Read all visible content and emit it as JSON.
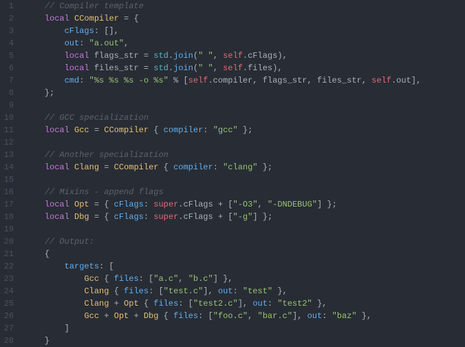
{
  "lines": [
    {
      "n": "1",
      "tokens": [
        [
          "    ",
          "c-white"
        ],
        [
          "// Compiler template",
          "c-comment"
        ]
      ]
    },
    {
      "n": "2",
      "tokens": [
        [
          "    ",
          "c-white"
        ],
        [
          "local",
          "c-keyword"
        ],
        [
          " ",
          "c-white"
        ],
        [
          "CCompiler",
          "c-def"
        ],
        [
          " = {",
          "c-punc"
        ]
      ]
    },
    {
      "n": "3",
      "tokens": [
        [
          "        ",
          "c-white"
        ],
        [
          "cFlags",
          "c-prop"
        ],
        [
          ":",
          "c-punc"
        ],
        [
          " [],",
          "c-punc"
        ]
      ]
    },
    {
      "n": "4",
      "tokens": [
        [
          "        ",
          "c-white"
        ],
        [
          "out",
          "c-prop"
        ],
        [
          ":",
          "c-punc"
        ],
        [
          " ",
          "c-white"
        ],
        [
          "\"a.out\"",
          "c-str"
        ],
        [
          ",",
          "c-punc"
        ]
      ]
    },
    {
      "n": "5",
      "tokens": [
        [
          "        ",
          "c-white"
        ],
        [
          "local",
          "c-keyword"
        ],
        [
          " ",
          "c-white"
        ],
        [
          "flags_str",
          "c-var"
        ],
        [
          " = ",
          "c-op"
        ],
        [
          "std",
          "c-builtin"
        ],
        [
          ".",
          "c-punc"
        ],
        [
          "join",
          "c-fn"
        ],
        [
          "(",
          "c-punc"
        ],
        [
          "\" \"",
          "c-str"
        ],
        [
          ", ",
          "c-punc"
        ],
        [
          "self",
          "c-self"
        ],
        [
          ".",
          "c-punc"
        ],
        [
          "cFlags",
          "c-var"
        ],
        [
          "),",
          "c-punc"
        ]
      ]
    },
    {
      "n": "6",
      "tokens": [
        [
          "        ",
          "c-white"
        ],
        [
          "local",
          "c-keyword"
        ],
        [
          " ",
          "c-white"
        ],
        [
          "files_str",
          "c-var"
        ],
        [
          " = ",
          "c-op"
        ],
        [
          "std",
          "c-builtin"
        ],
        [
          ".",
          "c-punc"
        ],
        [
          "join",
          "c-fn"
        ],
        [
          "(",
          "c-punc"
        ],
        [
          "\" \"",
          "c-str"
        ],
        [
          ", ",
          "c-punc"
        ],
        [
          "self",
          "c-self"
        ],
        [
          ".",
          "c-punc"
        ],
        [
          "files",
          "c-var"
        ],
        [
          "),",
          "c-punc"
        ]
      ]
    },
    {
      "n": "7",
      "tokens": [
        [
          "        ",
          "c-white"
        ],
        [
          "cmd",
          "c-prop"
        ],
        [
          ":",
          "c-punc"
        ],
        [
          " ",
          "c-white"
        ],
        [
          "\"%s %s %s -o %s\"",
          "c-str"
        ],
        [
          " % [",
          "c-punc"
        ],
        [
          "self",
          "c-self"
        ],
        [
          ".",
          "c-punc"
        ],
        [
          "compiler",
          "c-var"
        ],
        [
          ", ",
          "c-punc"
        ],
        [
          "flags_str",
          "c-var"
        ],
        [
          ", ",
          "c-punc"
        ],
        [
          "files_str",
          "c-var"
        ],
        [
          ", ",
          "c-punc"
        ],
        [
          "self",
          "c-self"
        ],
        [
          ".",
          "c-punc"
        ],
        [
          "out",
          "c-var"
        ],
        [
          "],",
          "c-punc"
        ]
      ]
    },
    {
      "n": "8",
      "tokens": [
        [
          "    };",
          "c-punc"
        ]
      ]
    },
    {
      "n": "9",
      "tokens": [
        [
          "",
          "c-white"
        ]
      ]
    },
    {
      "n": "10",
      "tokens": [
        [
          "    ",
          "c-white"
        ],
        [
          "// GCC specialization",
          "c-comment"
        ]
      ]
    },
    {
      "n": "11",
      "tokens": [
        [
          "    ",
          "c-white"
        ],
        [
          "local",
          "c-keyword"
        ],
        [
          " ",
          "c-white"
        ],
        [
          "Gcc",
          "c-def"
        ],
        [
          " = ",
          "c-punc"
        ],
        [
          "CCompiler",
          "c-def"
        ],
        [
          " { ",
          "c-punc"
        ],
        [
          "compiler",
          "c-prop"
        ],
        [
          ":",
          "c-punc"
        ],
        [
          " ",
          "c-white"
        ],
        [
          "\"gcc\"",
          "c-str"
        ],
        [
          " };",
          "c-punc"
        ]
      ]
    },
    {
      "n": "12",
      "tokens": [
        [
          "",
          "c-white"
        ]
      ]
    },
    {
      "n": "13",
      "tokens": [
        [
          "    ",
          "c-white"
        ],
        [
          "// Another specialization",
          "c-comment"
        ]
      ]
    },
    {
      "n": "14",
      "tokens": [
        [
          "    ",
          "c-white"
        ],
        [
          "local",
          "c-keyword"
        ],
        [
          " ",
          "c-white"
        ],
        [
          "Clang",
          "c-def"
        ],
        [
          " = ",
          "c-punc"
        ],
        [
          "CCompiler",
          "c-def"
        ],
        [
          " { ",
          "c-punc"
        ],
        [
          "compiler",
          "c-prop"
        ],
        [
          ":",
          "c-punc"
        ],
        [
          " ",
          "c-white"
        ],
        [
          "\"clang\"",
          "c-str"
        ],
        [
          " };",
          "c-punc"
        ]
      ]
    },
    {
      "n": "15",
      "tokens": [
        [
          "",
          "c-white"
        ]
      ]
    },
    {
      "n": "16",
      "tokens": [
        [
          "    ",
          "c-white"
        ],
        [
          "// Mixins - append flags",
          "c-comment"
        ]
      ]
    },
    {
      "n": "17",
      "tokens": [
        [
          "    ",
          "c-white"
        ],
        [
          "local",
          "c-keyword"
        ],
        [
          " ",
          "c-white"
        ],
        [
          "Opt",
          "c-def"
        ],
        [
          " = { ",
          "c-punc"
        ],
        [
          "cFlags",
          "c-prop"
        ],
        [
          ":",
          "c-punc"
        ],
        [
          " ",
          "c-white"
        ],
        [
          "super",
          "c-self"
        ],
        [
          ".",
          "c-punc"
        ],
        [
          "cFlags",
          "c-var"
        ],
        [
          " + [",
          "c-punc"
        ],
        [
          "\"-O3\"",
          "c-str"
        ],
        [
          ", ",
          "c-punc"
        ],
        [
          "\"-DNDEBUG\"",
          "c-str"
        ],
        [
          "] };",
          "c-punc"
        ]
      ]
    },
    {
      "n": "18",
      "tokens": [
        [
          "    ",
          "c-white"
        ],
        [
          "local",
          "c-keyword"
        ],
        [
          " ",
          "c-white"
        ],
        [
          "Dbg",
          "c-def"
        ],
        [
          " = { ",
          "c-punc"
        ],
        [
          "cFlags",
          "c-prop"
        ],
        [
          ":",
          "c-punc"
        ],
        [
          " ",
          "c-white"
        ],
        [
          "super",
          "c-self"
        ],
        [
          ".",
          "c-punc"
        ],
        [
          "cFlags",
          "c-var"
        ],
        [
          " + [",
          "c-punc"
        ],
        [
          "\"-g\"",
          "c-str"
        ],
        [
          "] };",
          "c-punc"
        ]
      ]
    },
    {
      "n": "19",
      "tokens": [
        [
          "",
          "c-white"
        ]
      ]
    },
    {
      "n": "20",
      "tokens": [
        [
          "    ",
          "c-white"
        ],
        [
          "// Output:",
          "c-comment"
        ]
      ]
    },
    {
      "n": "21",
      "tokens": [
        [
          "    {",
          "c-punc"
        ]
      ]
    },
    {
      "n": "22",
      "tokens": [
        [
          "        ",
          "c-white"
        ],
        [
          "targets",
          "c-prop"
        ],
        [
          ":",
          "c-punc"
        ],
        [
          " [",
          "c-punc"
        ]
      ]
    },
    {
      "n": "23",
      "tokens": [
        [
          "            ",
          "c-white"
        ],
        [
          "Gcc",
          "c-def"
        ],
        [
          " { ",
          "c-punc"
        ],
        [
          "files",
          "c-prop"
        ],
        [
          ":",
          "c-punc"
        ],
        [
          " [",
          "c-punc"
        ],
        [
          "\"a.c\"",
          "c-str"
        ],
        [
          ", ",
          "c-punc"
        ],
        [
          "\"b.c\"",
          "c-str"
        ],
        [
          "] },",
          "c-punc"
        ]
      ]
    },
    {
      "n": "24",
      "tokens": [
        [
          "            ",
          "c-white"
        ],
        [
          "Clang",
          "c-def"
        ],
        [
          " { ",
          "c-punc"
        ],
        [
          "files",
          "c-prop"
        ],
        [
          ":",
          "c-punc"
        ],
        [
          " [",
          "c-punc"
        ],
        [
          "\"test.c\"",
          "c-str"
        ],
        [
          "], ",
          "c-punc"
        ],
        [
          "out",
          "c-prop"
        ],
        [
          ":",
          "c-punc"
        ],
        [
          " ",
          "c-white"
        ],
        [
          "\"test\"",
          "c-str"
        ],
        [
          " },",
          "c-punc"
        ]
      ]
    },
    {
      "n": "25",
      "tokens": [
        [
          "            ",
          "c-white"
        ],
        [
          "Clang",
          "c-def"
        ],
        [
          " + ",
          "c-op"
        ],
        [
          "Opt",
          "c-def"
        ],
        [
          " { ",
          "c-punc"
        ],
        [
          "files",
          "c-prop"
        ],
        [
          ":",
          "c-punc"
        ],
        [
          " [",
          "c-punc"
        ],
        [
          "\"test2.c\"",
          "c-str"
        ],
        [
          "], ",
          "c-punc"
        ],
        [
          "out",
          "c-prop"
        ],
        [
          ":",
          "c-punc"
        ],
        [
          " ",
          "c-white"
        ],
        [
          "\"test2\"",
          "c-str"
        ],
        [
          " },",
          "c-punc"
        ]
      ]
    },
    {
      "n": "26",
      "tokens": [
        [
          "            ",
          "c-white"
        ],
        [
          "Gcc",
          "c-def"
        ],
        [
          " + ",
          "c-op"
        ],
        [
          "Opt",
          "c-def"
        ],
        [
          " + ",
          "c-op"
        ],
        [
          "Dbg",
          "c-def"
        ],
        [
          " { ",
          "c-punc"
        ],
        [
          "files",
          "c-prop"
        ],
        [
          ":",
          "c-punc"
        ],
        [
          " [",
          "c-punc"
        ],
        [
          "\"foo.c\"",
          "c-str"
        ],
        [
          ", ",
          "c-punc"
        ],
        [
          "\"bar.c\"",
          "c-str"
        ],
        [
          "], ",
          "c-punc"
        ],
        [
          "out",
          "c-prop"
        ],
        [
          ":",
          "c-punc"
        ],
        [
          " ",
          "c-white"
        ],
        [
          "\"baz\"",
          "c-str"
        ],
        [
          " },",
          "c-punc"
        ]
      ]
    },
    {
      "n": "27",
      "tokens": [
        [
          "        ]",
          "c-punc"
        ]
      ]
    },
    {
      "n": "28",
      "tokens": [
        [
          "    }",
          "c-punc"
        ]
      ]
    }
  ]
}
